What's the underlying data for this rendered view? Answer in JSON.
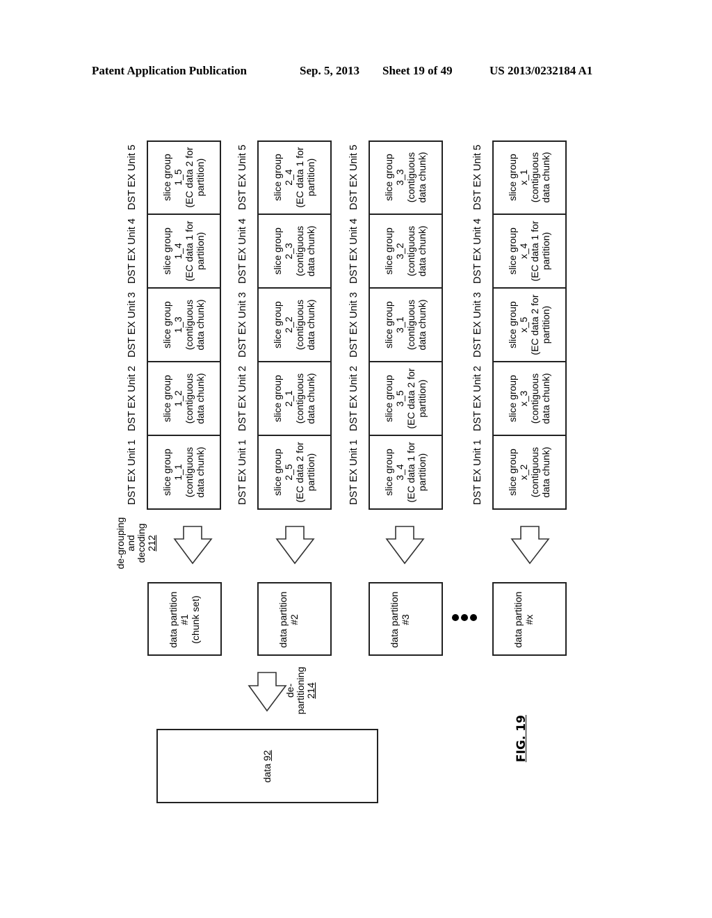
{
  "header": {
    "publication": "Patent Application Publication",
    "date": "Sep. 5, 2013",
    "sheet": "Sheet 19 of 49",
    "number": "US 2013/0232184 A1"
  },
  "unit_labels": [
    "DST EX Unit 1",
    "DST EX Unit 2",
    "DST EX Unit 3",
    "DST EX Unit 4",
    "DST EX Unit 5"
  ],
  "rows": [
    {
      "cells": [
        {
          "title": "slice group",
          "id": "1_1",
          "desc1": "(contiguous",
          "desc2": "data chunk)"
        },
        {
          "title": "slice group",
          "id": "1_2",
          "desc1": "(contiguous",
          "desc2": "data chunk)"
        },
        {
          "title": "slice group",
          "id": "1_3",
          "desc1": "(contiguous",
          "desc2": "data chunk)"
        },
        {
          "title": "slice group",
          "id": "1_4",
          "desc1": "(EC data 1 for",
          "desc2": "partition)"
        },
        {
          "title": "slice group",
          "id": "1_5",
          "desc1": "(EC data 2 for",
          "desc2": "partition)"
        }
      ],
      "partition": {
        "line1": "data partition",
        "line2": "#1",
        "line3": "(chunk set)"
      }
    },
    {
      "cells": [
        {
          "title": "slice group",
          "id": "2_5",
          "desc1": "(EC data 2 for",
          "desc2": "partition)"
        },
        {
          "title": "slice group",
          "id": "2_1",
          "desc1": "(contiguous",
          "desc2": "data chunk)"
        },
        {
          "title": "slice group",
          "id": "2_2",
          "desc1": "(contiguous",
          "desc2": "data chunk)"
        },
        {
          "title": "slice group",
          "id": "2_3",
          "desc1": "(contiguous",
          "desc2": "data chunk)"
        },
        {
          "title": "slice group",
          "id": "2_4",
          "desc1": "(EC data 1 for",
          "desc2": "partition)"
        }
      ],
      "partition": {
        "line1": "data partition",
        "line2": "#2",
        "line3": ""
      }
    },
    {
      "cells": [
        {
          "title": "slice group",
          "id": "3_4",
          "desc1": "(EC data 1 for",
          "desc2": "partition)"
        },
        {
          "title": "slice group",
          "id": "3_5",
          "desc1": "(EC data 2 for",
          "desc2": "partition)"
        },
        {
          "title": "slice group",
          "id": "3_1",
          "desc1": "(contiguous",
          "desc2": "data chunk)"
        },
        {
          "title": "slice group",
          "id": "3_2",
          "desc1": "(contiguous",
          "desc2": "data chunk)"
        },
        {
          "title": "slice group",
          "id": "3_3",
          "desc1": "(contiguous",
          "desc2": "data chunk)"
        }
      ],
      "partition": {
        "line1": "data partition",
        "line2": "#3",
        "line3": ""
      }
    },
    {
      "cells": [
        {
          "title": "slice group",
          "id": "x_2",
          "desc1": "(contiguous",
          "desc2": "data chunk)"
        },
        {
          "title": "slice group",
          "id": "x_3",
          "desc1": "(contiguous",
          "desc2": "data chunk)"
        },
        {
          "title": "slice group",
          "id": "x_5",
          "desc1": "(EC data 2 for",
          "desc2": "partition)"
        },
        {
          "title": "slice group",
          "id": "x_4",
          "desc1": "(EC data 1 for",
          "desc2": "partition)"
        },
        {
          "title": "slice group",
          "id": "x_1",
          "desc1": "(contiguous",
          "desc2": "data chunk)"
        }
      ],
      "partition": {
        "line1": "data partition",
        "line2": "#x",
        "line3": ""
      }
    }
  ],
  "degrouping_label": {
    "line1": "de-grouping",
    "line2": "and",
    "line3": "decoding",
    "ref": "212"
  },
  "departitioning_label": {
    "line1": "de-",
    "line2": "partitioning",
    "ref": "214"
  },
  "data_box": {
    "label": "data",
    "ref": "92"
  },
  "figure_label": "FIG. 19"
}
